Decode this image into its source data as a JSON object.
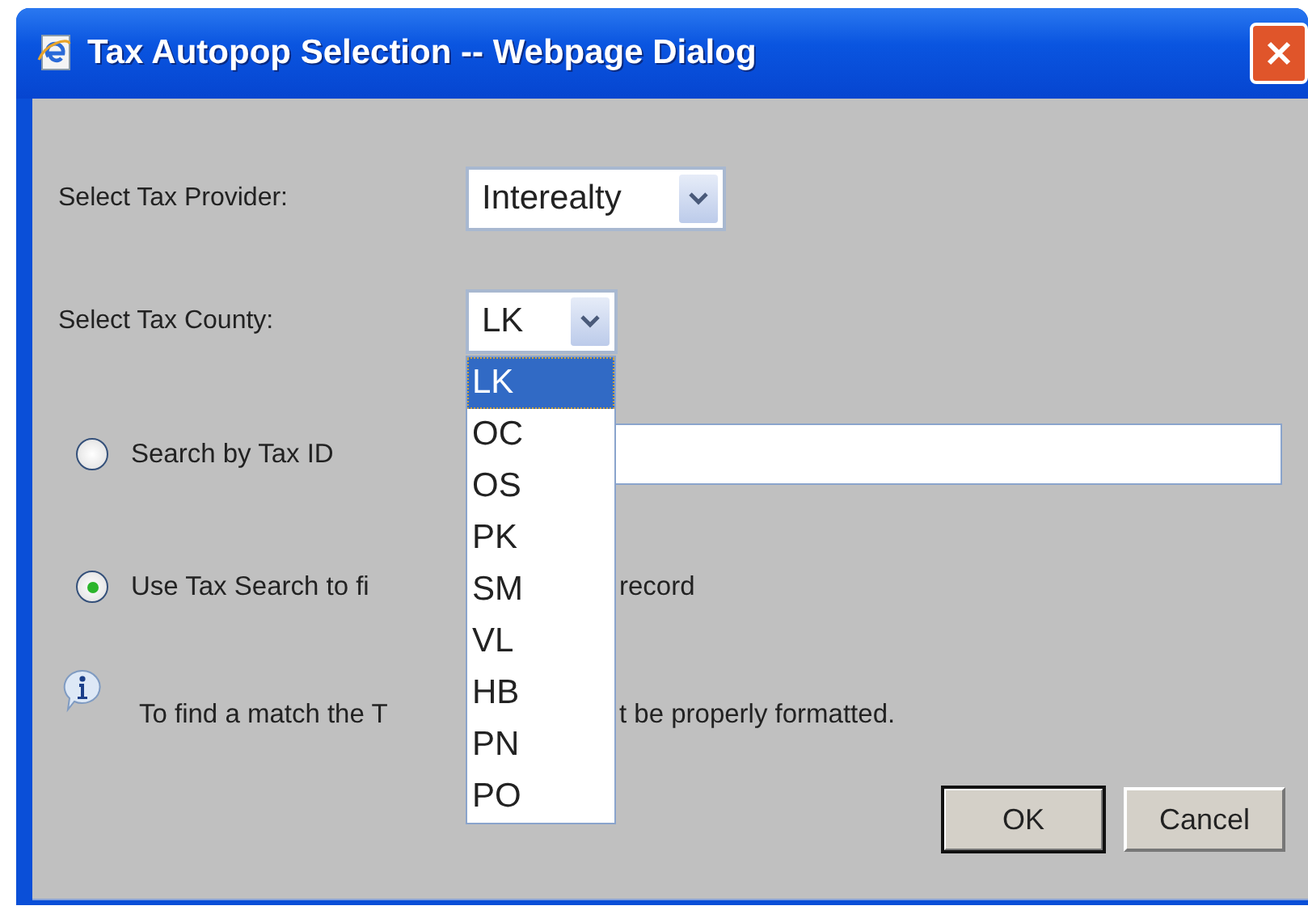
{
  "window": {
    "title": "Tax Autopop Selection -- Webpage Dialog"
  },
  "provider": {
    "label": "Select Tax Provider:",
    "value": "Interealty"
  },
  "county": {
    "label": "Select Tax County:",
    "value": "LK",
    "expanded": true,
    "options": [
      {
        "label": "LK",
        "selected": true
      },
      {
        "label": "OC",
        "selected": false
      },
      {
        "label": "OS",
        "selected": false
      },
      {
        "label": "PK",
        "selected": false
      },
      {
        "label": "SM",
        "selected": false
      },
      {
        "label": "VL",
        "selected": false
      },
      {
        "label": "HB",
        "selected": false
      },
      {
        "label": "PN",
        "selected": false
      },
      {
        "label": "PO",
        "selected": false
      }
    ]
  },
  "search_options": [
    {
      "kind": "field",
      "label": "Search by Tax ID",
      "selected": false
    },
    {
      "kind": "split",
      "label": "Use Tax Search to fi",
      "label_after": "record",
      "selected": true
    }
  ],
  "info": {
    "text": "To find a match the T",
    "text_after": "t be properly formatted."
  },
  "buttons": [
    {
      "label": "OK",
      "default": true
    },
    {
      "label": "Cancel",
      "default": false
    }
  ]
}
